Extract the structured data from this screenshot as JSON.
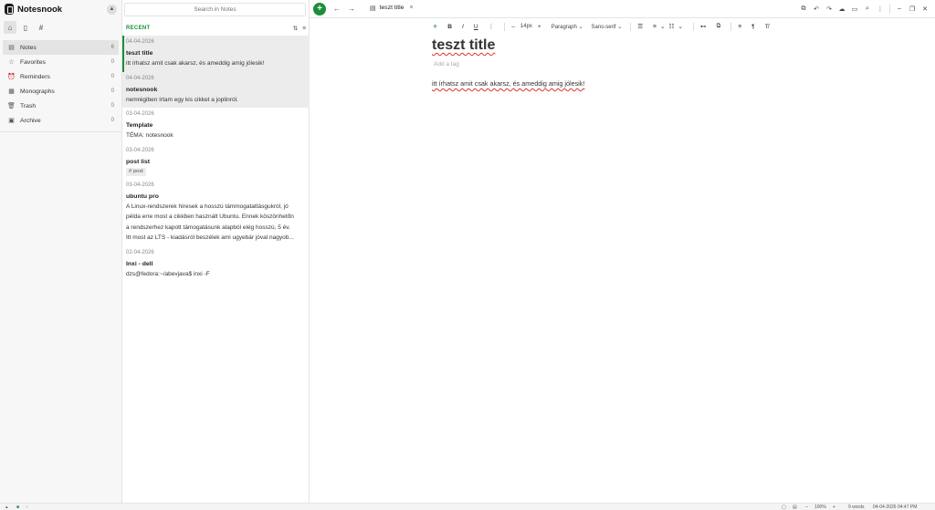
{
  "app": {
    "name": "Notesnook"
  },
  "sidebar": {
    "tabs": [
      {
        "icon": "home-icon",
        "glyph": "⌂"
      },
      {
        "icon": "notebook-icon",
        "glyph": "▯"
      },
      {
        "icon": "hash-icon",
        "glyph": "#"
      }
    ],
    "items": [
      {
        "label": "Notes",
        "count": "6",
        "icon": "note-icon",
        "glyph": "▤"
      },
      {
        "label": "Favorites",
        "count": "0",
        "icon": "star-icon",
        "glyph": "☆"
      },
      {
        "label": "Reminders",
        "count": "0",
        "icon": "bell-icon",
        "glyph": "⏰"
      },
      {
        "label": "Monographs",
        "count": "0",
        "icon": "monograph-icon",
        "glyph": "▦"
      },
      {
        "label": "Trash",
        "count": "0",
        "icon": "trash-icon",
        "glyph": "🗑"
      },
      {
        "label": "Archive",
        "count": "0",
        "icon": "archive-icon",
        "glyph": "▣"
      }
    ]
  },
  "search": {
    "placeholder": "Search in Notes"
  },
  "list": {
    "header": "RECENT",
    "notes": [
      {
        "date": "04-04-2026",
        "title": "teszt title",
        "lines": [
          "itt írhatsz amit csak akarsz, és ameddig amig jólesik!"
        ]
      },
      {
        "date": "04-04-2026",
        "title": "notesnook",
        "lines": [
          "nemrégiben írtam egy kis cikket a joplinról."
        ]
      },
      {
        "date": "03-04-2026",
        "title": "Template",
        "lines": [
          "TÉMA: notesnook"
        ]
      },
      {
        "date": "03-04-2026",
        "title": "post list",
        "tag": "# post"
      },
      {
        "date": "03-04-2026",
        "title": "ubuntu pro",
        "lines": [
          "A Linux-rendszerek híresek a hosszú támmogatattásgukról, jó",
          "példa erre most a cikkben használt Ubuntu. Ennek köszönhetőn",
          "a rendszerhez kapott támogatásunk alapból elég hosszú, 5 év.",
          "Itt most az LTS - kiadásról beszélek ami ugyebár jóval nagyob..."
        ]
      },
      {
        "date": "02-04-2026",
        "title": "Inxi - dell",
        "lines": [
          "dzs@fedora:~/abevjava$ inxi -F"
        ]
      }
    ]
  },
  "topbar": {
    "new_glyph": "+",
    "back_glyph": "←",
    "forward_glyph": "→",
    "tab_label": "teszt title",
    "tab_close": "×",
    "tools": [
      "⧉",
      "↶",
      "↷",
      "☁",
      "▭",
      "⌕",
      "⋮",
      "–",
      "❐",
      "✕"
    ]
  },
  "toolbar": {
    "insert": "+",
    "bold": "B",
    "italic": "I",
    "underline": "U",
    "more": "⋮",
    "minus": "–",
    "font_size": "14px",
    "plus": "+",
    "paragraph": "Paragraph",
    "font": "Sans-serif",
    "caret": "⌄",
    "bullets": "☰",
    "numbered": "≡",
    "checklist": "☷",
    "link": "⊷",
    "copy": "⧉",
    "align": "≡",
    "rtl": "¶",
    "clear": "T̸"
  },
  "editor": {
    "title": "teszt title",
    "add_tag": "Add a tag",
    "body": "itt írhatsz amit csak akarsz, és ameddig amig jólesik!"
  },
  "status": {
    "left_a": "▴",
    "left_b": "■",
    "left_c": "◌",
    "zoom": "100%",
    "words": "9 words",
    "datetime": "04-04-2026 04:47 PM"
  }
}
